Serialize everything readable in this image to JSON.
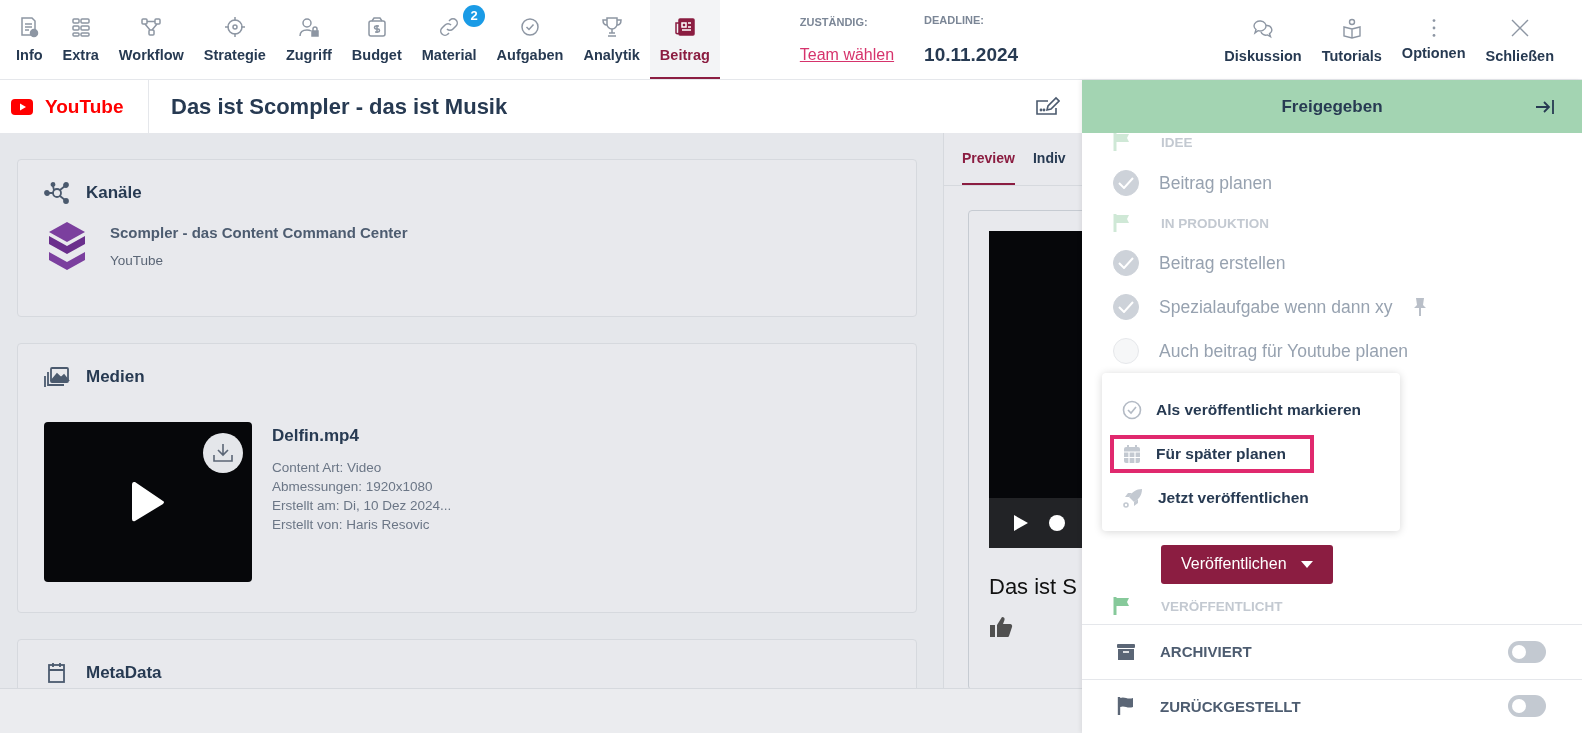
{
  "tabs": [
    {
      "label": "Info",
      "selected": false
    },
    {
      "label": "Extra",
      "selected": false
    },
    {
      "label": "Workflow",
      "selected": false
    },
    {
      "label": "Strategie",
      "selected": false
    },
    {
      "label": "Zugriff",
      "selected": false
    },
    {
      "label": "Budget",
      "selected": false
    },
    {
      "label": "Material",
      "selected": false,
      "badge": "2"
    },
    {
      "label": "Aufgaben",
      "selected": false
    },
    {
      "label": "Analytik",
      "selected": false
    },
    {
      "label": "Beitrag",
      "selected": true
    }
  ],
  "assignee": {
    "label": "ZUSTÄNDIG:",
    "link": "Team wählen"
  },
  "deadline": {
    "label": "DEADLINE:",
    "value": "10.11.2024"
  },
  "actions": [
    "Diskussion",
    "Tutorials",
    "Optionen",
    "Schließen"
  ],
  "channel_label": "YouTube",
  "post_title": "Das ist Scompler - das ist Musik",
  "channels_card": {
    "title": "Kanäle",
    "channel_name": "Scompler - das Content Command Center",
    "channel_type": "YouTube"
  },
  "media_card": {
    "title": "Medien",
    "file_name": "Delfin.mp4",
    "details": [
      "Content Art: Video",
      "Abmessungen: 1920x1080",
      "Erstellt am: Di, 10 Dez 2024...",
      "Erstellt von: Haris Resovic"
    ]
  },
  "metadata_card": {
    "title": "MetaData"
  },
  "preview": {
    "tabs": [
      {
        "label": "Preview",
        "selected": true
      },
      {
        "label": "Indiv",
        "selected": false
      }
    ],
    "video_title": "Das ist S"
  },
  "status_panel": {
    "status": "Freigegeben",
    "workflow": [
      {
        "kind": "phase",
        "label": "IDEE"
      },
      {
        "kind": "task",
        "label": "Beitrag planen",
        "checked": true
      },
      {
        "kind": "phase",
        "label": "IN PRODUKTION"
      },
      {
        "kind": "task",
        "label": "Beitrag erstellen",
        "checked": true
      },
      {
        "kind": "task",
        "label": "Spezialaufgabe wenn dann xy",
        "checked": true,
        "pinned": true
      },
      {
        "kind": "task",
        "label": "Auch beitrag für Youtube planen",
        "checked": false
      }
    ],
    "publish_menu": [
      {
        "kind": "check",
        "label": "Als veröffentlicht markieren",
        "highlighted": false
      },
      {
        "kind": "calendar",
        "label": "Für später planen",
        "highlighted": true
      },
      {
        "kind": "rocket",
        "label": "Jetzt veröffentlichen",
        "highlighted": false
      }
    ],
    "publish_button": "Veröffentlichen",
    "final_phase": "VERÖFFENTLICHT",
    "toggles": [
      {
        "kind": "archive",
        "label": "ARCHIVIERT",
        "on": false
      },
      {
        "kind": "flag",
        "label": "ZURÜCKGESTELLT",
        "on": false
      }
    ]
  }
}
